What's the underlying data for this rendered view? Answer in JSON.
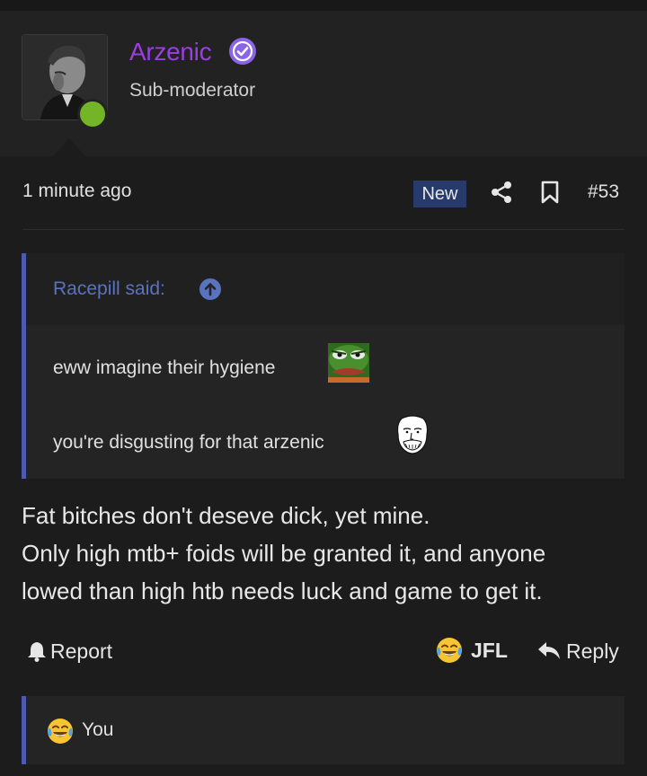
{
  "post": {
    "username": "Arzenic",
    "role": "Sub-moderator",
    "time": "1 minute ago",
    "badge": "New",
    "post_number": "#53"
  },
  "quote": {
    "author": "Racepill said:",
    "line1": "eww imagine their hygiene",
    "line2": "you're disgusting for that arzenic"
  },
  "body": [
    "Fat bitches don't deseve dick, yet mine.",
    "Only high mtb+ foids will be granted it, and anyone",
    "lowed than high htb needs luck and game to get it."
  ],
  "actions": {
    "report": "Report",
    "reaction": "JFL",
    "reply": "Reply"
  },
  "reactions_bar": {
    "label": "You"
  },
  "colors": {
    "username": "#9b3fe0",
    "verified": "#8a63e8",
    "online": "#73b526",
    "quote_accent": "#4c5ab0",
    "new_badge": "#263b6b"
  },
  "icons": {
    "verified": "verified-check-icon",
    "share": "share-icon",
    "bookmark": "bookmark-icon",
    "jump_up": "arrow-up-circle-icon",
    "report": "bell-icon",
    "reaction": "crying-laughing-emoji-icon",
    "reply": "reply-arrow-icon"
  }
}
